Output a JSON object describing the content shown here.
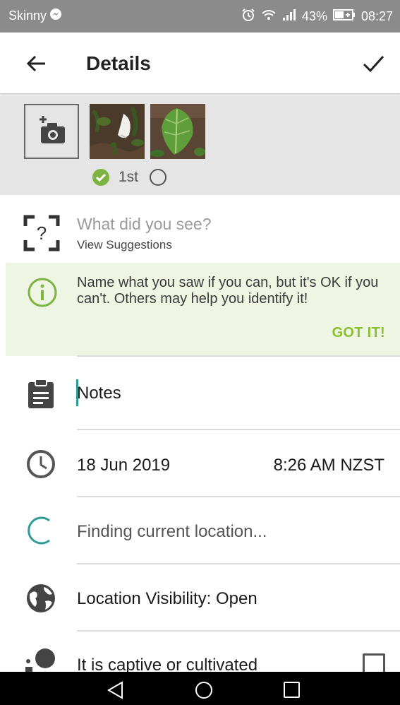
{
  "status_bar": {
    "carrier": "Skinny",
    "battery": "43%",
    "time": "08:27",
    "icons": [
      "messenger-icon",
      "alarm-icon",
      "wifi-icon",
      "signal-icon",
      "battery-icon"
    ]
  },
  "app_bar": {
    "title": "Details",
    "back_icon": "arrow-left-icon",
    "done_icon": "checkmark-icon"
  },
  "photos": {
    "add_icon": "add-photo-camera-icon",
    "first_label": "1st"
  },
  "species": {
    "prompt": "What did you see?",
    "suggestions_label": "View Suggestions"
  },
  "tip": {
    "text": "Name what you saw if you can, but it's OK if you can't. Others may help you identify it!",
    "got_it": "GOT IT!"
  },
  "notes": {
    "placeholder": "Notes"
  },
  "datetime": {
    "date": "18 Jun 2019",
    "time": "8:26 AM NZST"
  },
  "location": {
    "text": "Finding current location..."
  },
  "visibility": {
    "text": "Location Visibility: Open"
  },
  "captive": {
    "text": "It is captive or cultivated",
    "checked": false
  },
  "colors": {
    "accent_green": "#8cbf2f",
    "teal": "#2e9c94",
    "tip_background": "#eef5e3"
  }
}
